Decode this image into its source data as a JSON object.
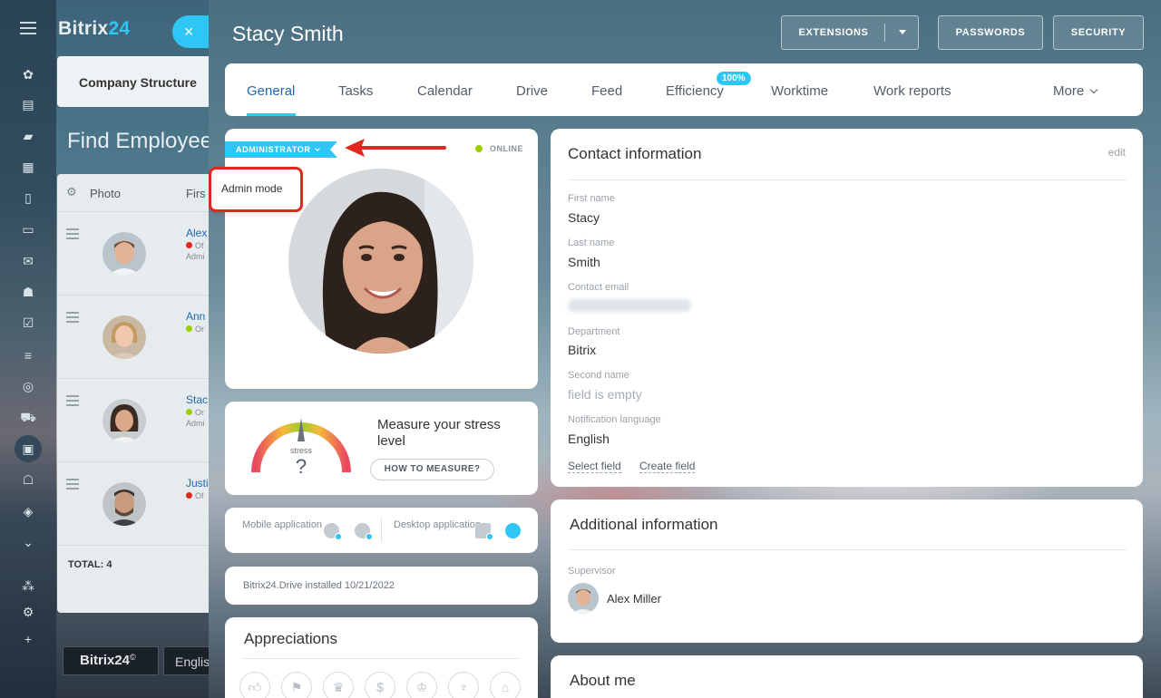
{
  "portal": {
    "logo_main": "Bitrix",
    "logo_accent": "24",
    "close_icon": "×",
    "company_tab": "Company Structure",
    "find_title": "Find Employee",
    "table_headers": {
      "photo": "Photo",
      "first": "Firs"
    },
    "rows": [
      {
        "name": "Alex",
        "status": "Of",
        "admin": "Admi"
      },
      {
        "name": "Ann",
        "status": "Or",
        "admin": ""
      },
      {
        "name": "Stac",
        "status": "Or",
        "admin": "Admi"
      },
      {
        "name": "Justi",
        "status": "Of",
        "admin": ""
      }
    ],
    "total": "TOTAL: 4",
    "bottom_logo": "Bitrix24",
    "bottom_lang": "Englis"
  },
  "profile": {
    "name": "Stacy Smith",
    "buttons": {
      "extensions": "EXTENSIONS",
      "passwords": "PASSWORDS",
      "security": "SECURITY"
    },
    "tabs": [
      {
        "label": "General"
      },
      {
        "label": "Tasks"
      },
      {
        "label": "Calendar"
      },
      {
        "label": "Drive"
      },
      {
        "label": "Feed"
      },
      {
        "label": "Efficiency"
      },
      {
        "label": "Worktime"
      },
      {
        "label": "Work reports"
      },
      {
        "label": "More"
      }
    ],
    "efficiency_badge": "100%",
    "role_badge": "ADMINISTRATOR",
    "online_status": "ONLINE",
    "admin_popup": "Admin mode",
    "stress": {
      "gauge_label": "stress",
      "gauge_value": "?",
      "title": "Measure your stress level",
      "button": "HOW TO MEASURE?"
    },
    "apps": {
      "mobile": "Mobile application",
      "desktop": "Desktop application"
    },
    "drive_installed": "Bitrix24.Drive installed 10/21/2022",
    "appreciations_title": "Appreciations",
    "contact": {
      "title": "Contact information",
      "edit": "edit",
      "fields": [
        {
          "label": "First name",
          "value": "Stacy"
        },
        {
          "label": "Last name",
          "value": "Smith"
        },
        {
          "label": "Contact email",
          "value": ""
        },
        {
          "label": "Department",
          "value": "Bitrix"
        },
        {
          "label": "Second name",
          "value": "field is empty"
        },
        {
          "label": "Notification language",
          "value": "English"
        }
      ],
      "select_field": "Select field",
      "create_field": "Create field"
    },
    "additional": {
      "title": "Additional information",
      "supervisor_label": "Supervisor",
      "supervisor_name": "Alex Miller"
    },
    "about_title": "About me"
  },
  "colors": {
    "accent": "#2fc6f6",
    "link": "#2067b0",
    "online": "#9dcf00",
    "offline": "#e0281e",
    "highlight": "#e0281e"
  }
}
